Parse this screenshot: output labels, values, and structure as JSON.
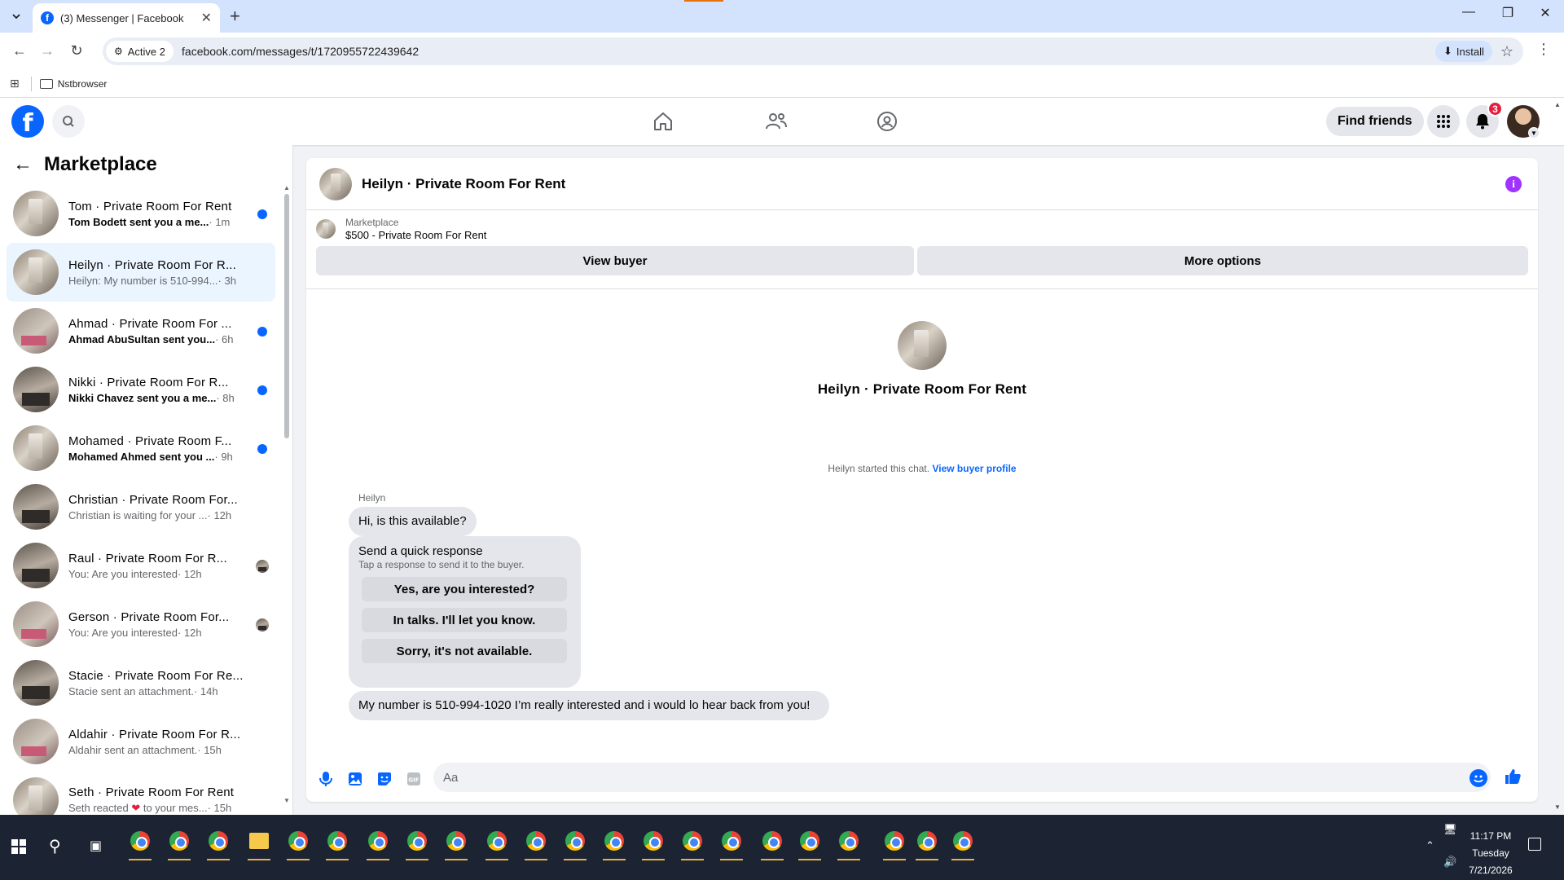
{
  "browser": {
    "tab_title": "(3) Messenger | Facebook",
    "new_tab": "+",
    "site_info": "Active 2",
    "url": "facebook.com/messages/t/1720955722439642",
    "install_label": "Install",
    "bookmark_folder": "Nstbrowser"
  },
  "fbnav": {
    "find_friends": "Find friends",
    "notification_count": "3"
  },
  "sidebar": {
    "title": "Marketplace",
    "conversations": [
      {
        "name": "Tom · Private Room For Rent",
        "snippet": "Tom Bodett sent you a me...",
        "time": " · 1m",
        "unread": true,
        "avatar": "room"
      },
      {
        "name": "Heilyn · Private Room For R...",
        "snippet": "Heilyn: My number is 510-994...",
        "time": " · 3h",
        "unread": false,
        "avatar": "room",
        "active": true
      },
      {
        "name": "Ahmad · Private Room For ...",
        "snippet": "Ahmad AbuSultan sent you...",
        "time": " · 6h",
        "unread": true,
        "avatar": "room3"
      },
      {
        "name": "Nikki · Private Room For R...",
        "snippet": "Nikki Chavez sent you a me...",
        "time": " · 8h",
        "unread": true,
        "avatar": "room2"
      },
      {
        "name": "Mohamed · Private Room F...",
        "snippet": "Mohamed Ahmed sent you ...",
        "time": " · 9h",
        "unread": true,
        "avatar": "room"
      },
      {
        "name": "Christian · Private Room For...",
        "snippet": "Christian is waiting for your ...",
        "time": " · 12h",
        "unread": false,
        "avatar": "room2"
      },
      {
        "name": "Raul · Private Room For R...",
        "snippet": "You: Are you interested",
        "time": " · 12h",
        "unread": false,
        "avatar": "room2"
      },
      {
        "name": "Gerson · Private Room For...",
        "snippet": "You: Are you interested",
        "time": " · 12h",
        "unread": false,
        "avatar": "room3"
      },
      {
        "name": "Stacie · Private Room For Re...",
        "snippet": "Stacie sent an attachment.",
        "time": " · 14h",
        "unread": false,
        "avatar": "room2"
      },
      {
        "name": "Aldahir · Private Room For R...",
        "snippet": "Aldahir sent an attachment.",
        "time": " · 15h",
        "unread": false,
        "avatar": "room3"
      },
      {
        "name": "Seth · Private Room For Rent",
        "snippet": "Seth reacted ❤ to your mes...",
        "time": " · 15h",
        "unread": false,
        "avatar": "room"
      }
    ]
  },
  "chat": {
    "header_name": "Heilyn · Private Room For Rent",
    "marketplace_label": "Marketplace",
    "listing": "$500 - Private Room For Rent",
    "view_buyer": "View buyer",
    "more_options": "More options",
    "intro_name": "Heilyn · Private Room For Rent",
    "started_text": "Heilyn started this chat.",
    "started_link": "View buyer profile",
    "sender": "Heilyn",
    "message_1": "Hi, is this available?",
    "quick_title": "Send a quick response",
    "quick_sub": "Tap a response to send it to the buyer.",
    "quick_replies": [
      "Yes, are you interested?",
      "In talks. I'll let you know.",
      "Sorry, it's not available."
    ],
    "message_2": "My number is 510-994-1020 I’m really interested and i would lo hear back from you!",
    "composer_placeholder": "Aa"
  },
  "taskbar": {
    "time": "11:17 PM",
    "day": "Tuesday",
    "date": "7/21/2026"
  },
  "colors": {
    "fb_blue": "#0866ff",
    "active_conv_bg": "#ebf5ff",
    "bubble_gray": "#e4e6eb",
    "info_purple": "#a033ff",
    "tab_bar": "#d3e3fd",
    "taskbar": "#1c2433"
  },
  "icons": [
    "search-icon",
    "home-icon",
    "friends-icon",
    "groups-icon",
    "menu-grid-icon",
    "bell-icon",
    "back-arrow-icon",
    "info-icon",
    "microphone-icon",
    "image-icon",
    "sticker-icon",
    "gif-icon",
    "emoji-icon",
    "like-icon"
  ]
}
